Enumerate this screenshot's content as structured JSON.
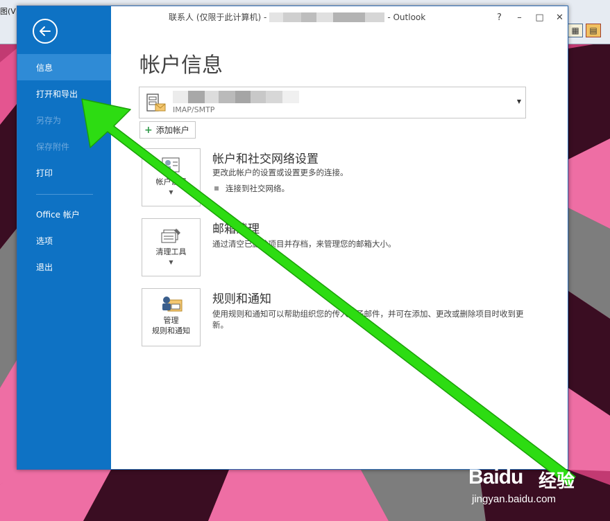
{
  "background": {
    "menu_fragment": "图(V)",
    "colors": {
      "desktop": "#c23a72",
      "shard_dark": "#3a0d22",
      "shard_gray": "#7d7d7d",
      "shard_light": "#ee6ea4"
    }
  },
  "window": {
    "title": "联系人 (仅限于此计算机) -",
    "title_suffix": "- Outlook",
    "controls": {
      "help": "?",
      "minimize": "–",
      "maximize": "□",
      "close": "✕"
    }
  },
  "sidebar": {
    "back_icon": "back-arrow-icon",
    "items": [
      {
        "label": "信息",
        "state": "active"
      },
      {
        "label": "打开和导出",
        "state": "normal"
      },
      {
        "label": "另存为",
        "state": "disabled"
      },
      {
        "label": "保存附件",
        "state": "disabled"
      },
      {
        "label": "打印",
        "state": "normal"
      },
      {
        "label": "Office 帐户",
        "state": "normal"
      },
      {
        "label": "选项",
        "state": "normal"
      },
      {
        "label": "退出",
        "state": "normal"
      }
    ],
    "colors": {
      "background": "#0e72c4",
      "active": "#2f8bd6",
      "disabled_text": "#6fa9dc"
    }
  },
  "main": {
    "title": "帐户信息",
    "account": {
      "type": "IMAP/SMTP",
      "icon": "mail-server-icon"
    },
    "add_account": {
      "label": "添加帐户",
      "icon": "plus-icon"
    },
    "sections": [
      {
        "button_label": "帐户设置",
        "title": "帐户和社交网络设置",
        "desc": "更改此帐户的设置或设置更多的连接。",
        "bullet": "连接到社交网络。",
        "icon": "account-settings-icon"
      },
      {
        "button_label": "清理工具",
        "title": "邮箱清理",
        "desc": "通过清空已删除项目并存档，来管理您的邮箱大小。",
        "icon": "cleanup-tools-icon"
      },
      {
        "button_label_1": "管理",
        "button_label_2": "规则和通知",
        "title": "规则和通知",
        "desc": "使用规则和通知可以帮助组织您的传入电子邮件，并可在添加、更改或删除项目时收到更新。",
        "icon": "rules-alerts-icon"
      }
    ]
  },
  "annotation": {
    "color": "#2ddc12",
    "icon": "green-arrow-icon"
  },
  "watermark": {
    "brand": "Baidu",
    "cn": "经验",
    "url": "jingyan.baidu.com"
  }
}
